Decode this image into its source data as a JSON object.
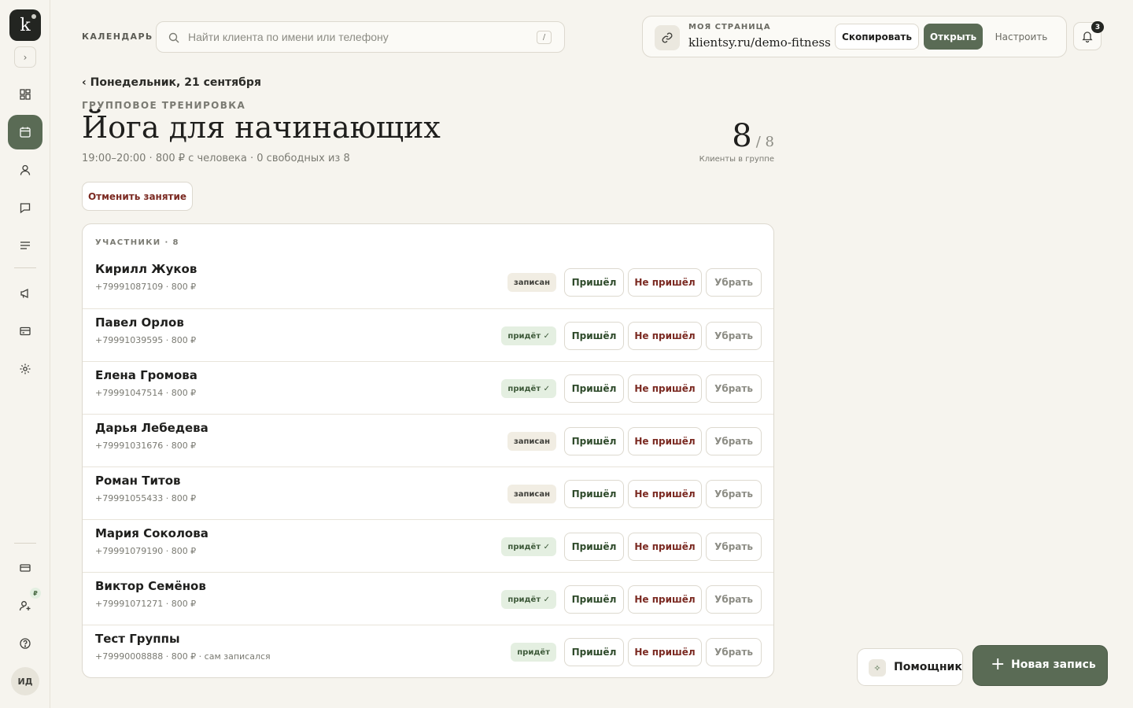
{
  "brand": {
    "logo_letter": "k"
  },
  "header": {
    "section_label": "КАЛЕНДАРЬ",
    "search_placeholder": "Найти клиента по имени или телефону",
    "search_shortcut": "/",
    "mypage_label": "МОЯ СТРАНИЦА",
    "mypage_url": "klientsy.ru/demo-fitness",
    "copy_label": "Скопировать",
    "open_label": "Открыть",
    "setup_label": "Настроить",
    "notifications_count": "3"
  },
  "session": {
    "back_label": "‹ Понедельник, 21 сентября",
    "eyebrow": "ГРУППОВОЕ ТРЕНИРОВКА",
    "title": "Йога для начинающих",
    "meta": "19:00–20:00 · 800 ₽ с человека · 0 свободных из 8",
    "count_value": "8",
    "count_capacity": "/ 8",
    "count_label": "Клиенты в группе",
    "cancel_label": "Отменить занятие"
  },
  "participants": {
    "title": "УЧАСТНИКИ · 8",
    "came_label": "Пришёл",
    "missed_label": "Не пришёл",
    "remove_label": "Убрать",
    "rows": [
      {
        "name": "Кирилл Жуков",
        "sub": "+79991087109 · 800 ₽",
        "status": "записан",
        "status_kind": "gray"
      },
      {
        "name": "Павел Орлов",
        "sub": "+79991039595 · 800 ₽",
        "status": "придёт ✓",
        "status_kind": "green"
      },
      {
        "name": "Елена Громова",
        "sub": "+79991047514 · 800 ₽",
        "status": "придёт ✓",
        "status_kind": "green"
      },
      {
        "name": "Дарья Лебедева",
        "sub": "+79991031676 · 800 ₽",
        "status": "записан",
        "status_kind": "gray"
      },
      {
        "name": "Роман Титов",
        "sub": "+79991055433 · 800 ₽",
        "status": "записан",
        "status_kind": "gray"
      },
      {
        "name": "Мария Соколова",
        "sub": "+79991079190 · 800 ₽",
        "status": "придёт ✓",
        "status_kind": "green"
      },
      {
        "name": "Виктор Семёнов",
        "sub": "+79991071271 · 800 ₽",
        "status": "придёт ✓",
        "status_kind": "green"
      },
      {
        "name": "Тест Группы",
        "sub": "+79990008888 · 800 ₽ · сам записался",
        "status": "придёт",
        "status_kind": "green"
      }
    ]
  },
  "footer": {
    "assistant_label": "Помощник",
    "new_record_label": "Новая запись"
  },
  "sidebar": {
    "currency_badge": "₽",
    "avatar_initials": "ИД"
  },
  "colors": {
    "accent": "#5a6b55",
    "danger": "#7b2a22",
    "background": "#f6f4ee"
  }
}
